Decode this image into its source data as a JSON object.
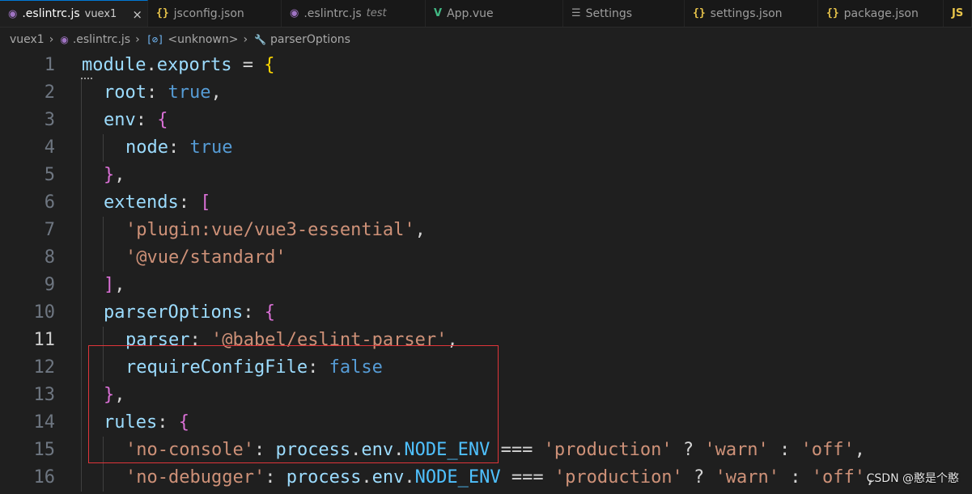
{
  "tabs": [
    {
      "name": ".eslintrc.js",
      "desc": "vuex1",
      "icon": "eslint-icon",
      "active": true
    },
    {
      "name": "jsconfig.json",
      "desc": "",
      "icon": "json-icon",
      "active": false
    },
    {
      "name": ".eslintrc.js",
      "desc": "test",
      "icon": "eslint-icon",
      "active": false
    },
    {
      "name": "App.vue",
      "desc": "",
      "icon": "vue-icon",
      "active": false
    },
    {
      "name": "Settings",
      "desc": "",
      "icon": "settings-icon",
      "active": false
    },
    {
      "name": "settings.json",
      "desc": "",
      "icon": "json-icon",
      "active": false
    },
    {
      "name": "package.json",
      "desc": "",
      "icon": "json-icon",
      "active": false
    },
    {
      "name": "",
      "desc": "",
      "icon": "js-icon",
      "active": false
    }
  ],
  "icons": {
    "close": "×",
    "eslint": "◉",
    "json": "{}",
    "vue": "V",
    "settings": "☰",
    "js": "JS",
    "unknown": "[⊘]",
    "wrench": "🔧",
    "chevron": "›"
  },
  "breadcrumb": [
    {
      "label": "vuex1",
      "icon": ""
    },
    {
      "label": ".eslintrc.js",
      "icon": "eslint"
    },
    {
      "label": "<unknown>",
      "icon": "unknown"
    },
    {
      "label": "parserOptions",
      "icon": "wrench"
    }
  ],
  "editor": {
    "current_line": 11,
    "lines": [
      {
        "n": "1",
        "indent": 0,
        "tokens": [
          [
            "t-var",
            "module"
          ],
          [
            "t-text",
            "."
          ],
          [
            "t-var",
            "exports"
          ],
          [
            "t-text",
            " = "
          ],
          [
            "t-brk1",
            "{"
          ]
        ]
      },
      {
        "n": "2",
        "indent": 1,
        "tokens": [
          [
            "t-var",
            "root"
          ],
          [
            "t-text",
            ": "
          ],
          [
            "t-kw",
            "true"
          ],
          [
            "t-text",
            ","
          ]
        ]
      },
      {
        "n": "3",
        "indent": 1,
        "tokens": [
          [
            "t-var",
            "env"
          ],
          [
            "t-text",
            ": "
          ],
          [
            "t-brk2",
            "{"
          ]
        ]
      },
      {
        "n": "4",
        "indent": 2,
        "tokens": [
          [
            "t-var",
            "node"
          ],
          [
            "t-text",
            ": "
          ],
          [
            "t-kw",
            "true"
          ]
        ]
      },
      {
        "n": "5",
        "indent": 1,
        "tokens": [
          [
            "t-brk2",
            "}"
          ],
          [
            "t-text",
            ","
          ]
        ]
      },
      {
        "n": "6",
        "indent": 1,
        "tokens": [
          [
            "t-var",
            "extends"
          ],
          [
            "t-text",
            ": "
          ],
          [
            "t-brk2",
            "["
          ]
        ]
      },
      {
        "n": "7",
        "indent": 2,
        "tokens": [
          [
            "t-str",
            "'plugin:vue/vue3-essential'"
          ],
          [
            "t-text",
            ","
          ]
        ]
      },
      {
        "n": "8",
        "indent": 2,
        "tokens": [
          [
            "t-str",
            "'@vue/standard'"
          ]
        ]
      },
      {
        "n": "9",
        "indent": 1,
        "tokens": [
          [
            "t-brk2",
            "]"
          ],
          [
            "t-text",
            ","
          ]
        ]
      },
      {
        "n": "10",
        "indent": 1,
        "tokens": [
          [
            "t-var",
            "parserOptions"
          ],
          [
            "t-text",
            ": "
          ],
          [
            "t-brk2",
            "{"
          ]
        ]
      },
      {
        "n": "11",
        "indent": 2,
        "tokens": [
          [
            "t-var",
            "parser"
          ],
          [
            "t-text",
            ": "
          ],
          [
            "t-str",
            "'@babel/eslint-parser'"
          ],
          [
            "t-text",
            ","
          ]
        ]
      },
      {
        "n": "12",
        "indent": 2,
        "tokens": [
          [
            "t-var",
            "requireConfigFile"
          ],
          [
            "t-text",
            ": "
          ],
          [
            "t-kw",
            "false"
          ]
        ]
      },
      {
        "n": "13",
        "indent": 1,
        "tokens": [
          [
            "t-brk2",
            "}"
          ],
          [
            "t-text",
            ","
          ]
        ]
      },
      {
        "n": "14",
        "indent": 1,
        "tokens": [
          [
            "t-var",
            "rules"
          ],
          [
            "t-text",
            ": "
          ],
          [
            "t-brk2",
            "{"
          ]
        ]
      },
      {
        "n": "15",
        "indent": 2,
        "tokens": [
          [
            "t-str",
            "'no-console'"
          ],
          [
            "t-text",
            ": "
          ],
          [
            "t-var",
            "process"
          ],
          [
            "t-text",
            "."
          ],
          [
            "t-var",
            "env"
          ],
          [
            "t-text",
            "."
          ],
          [
            "t-const",
            "NODE_ENV"
          ],
          [
            "t-text",
            " === "
          ],
          [
            "t-str",
            "'production'"
          ],
          [
            "t-text",
            " ? "
          ],
          [
            "t-str",
            "'warn'"
          ],
          [
            "t-text",
            " : "
          ],
          [
            "t-str",
            "'off'"
          ],
          [
            "t-text",
            ","
          ]
        ]
      },
      {
        "n": "16",
        "indent": 2,
        "tokens": [
          [
            "t-str",
            "'no-debugger'"
          ],
          [
            "t-text",
            ": "
          ],
          [
            "t-var",
            "process"
          ],
          [
            "t-text",
            "."
          ],
          [
            "t-var",
            "env"
          ],
          [
            "t-text",
            "."
          ],
          [
            "t-const",
            "NODE_ENV"
          ],
          [
            "t-text",
            " === "
          ],
          [
            "t-str",
            "'production'"
          ],
          [
            "t-text",
            " ? "
          ],
          [
            "t-str",
            "'warn'"
          ],
          [
            "t-text",
            " : "
          ],
          [
            "t-str",
            "'off'"
          ],
          [
            "t-text",
            ","
          ]
        ]
      }
    ]
  },
  "watermark": "CSDN @憨是个憨"
}
